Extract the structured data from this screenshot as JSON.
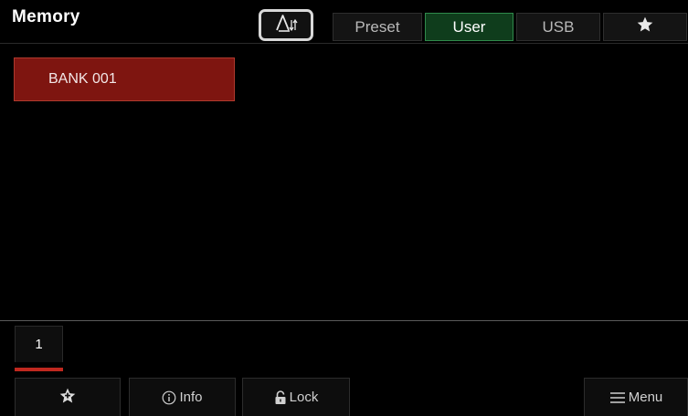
{
  "header": {
    "title": "Memory",
    "tabs": [
      {
        "label": "Preset",
        "active": false
      },
      {
        "label": "User",
        "active": true
      },
      {
        "label": "USB",
        "active": false
      }
    ],
    "favorite_tab_icon": "star-icon",
    "sort_icon": "sort-alpha-icon"
  },
  "list": {
    "items": [
      {
        "label": "BANK 001",
        "selected": true
      }
    ]
  },
  "pagination": {
    "current_page": "1"
  },
  "softkeys": {
    "favorite_icon": "star-outline-icon",
    "info_label": "Info",
    "lock_label": "Lock",
    "menu_label": "Menu"
  },
  "colors": {
    "background": "#000000",
    "selected_item": "#7e1510",
    "active_tab": "#0f3d1c",
    "page_indicator": "#c0281f"
  }
}
